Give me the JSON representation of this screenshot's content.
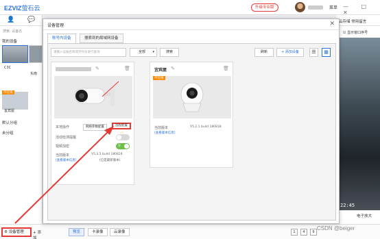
{
  "app": {
    "logo": "EZVIZ",
    "logo_cn": "萤石云",
    "upgrade_label": "升级专业版",
    "menu_label": "菜单",
    "window_controls": "— □ ✕"
  },
  "sidebar": {
    "search_placeholder": "搜索: 设备名",
    "my_devices_label": "我的设备",
    "thumb1_label": "C3C",
    "thumb2_label": "东南",
    "offline_tag": "不在线",
    "thumb3_label": "宜宾屋",
    "default_group": "默认分组",
    "unassigned_group": "未分组",
    "device_mgmt_label": "设备管理",
    "add_label": "添加"
  },
  "right": {
    "top_labels": "云存储  常用留言",
    "window_number_label": "显示窗口序号",
    "timestamp": "22:45",
    "zoom_label": "电子放大"
  },
  "bottombar": {
    "tabs": [
      "预览",
      "卡录像",
      "云录像"
    ],
    "grid": [
      "1",
      "4",
      "9"
    ]
  },
  "watermark": "CSDN @beiger",
  "modal": {
    "title": "设备管理",
    "close": "✕",
    "tabs": [
      "账号内设备",
      "搜索到的局域网设备"
    ],
    "search_placeholder": "请输入设备名称或序列号进行查询",
    "select_value": "全部",
    "search_button": "搜索",
    "refresh_button": "刷新",
    "add_device_button": "+ 添加设备",
    "cards": [
      {
        "name": "",
        "operations_label": "本地操作",
        "network_config_button": "网络参数配置",
        "remote_config_button": "远程配置",
        "motion_label": "活动检测提醒",
        "encrypt_label": "视频加密",
        "encrypt_toggle": "开",
        "firmware_label": "当前版本",
        "firmware_value": "V5.3.5 build 180824",
        "update_label": "(已是最新版本)",
        "link_label": "[查看版本信息]"
      },
      {
        "name": "宜宾屋",
        "offline_badge": "不在线",
        "firmware_label": "当前版本",
        "firmware_value": "V5.2.1 build 180818",
        "link_label": "[查看版本信息]"
      }
    ]
  },
  "colors": {
    "accent": "#2a6fdb",
    "highlight": "#e53935",
    "offline": "#ff8a00",
    "toggle_on": "#6cc04a"
  }
}
